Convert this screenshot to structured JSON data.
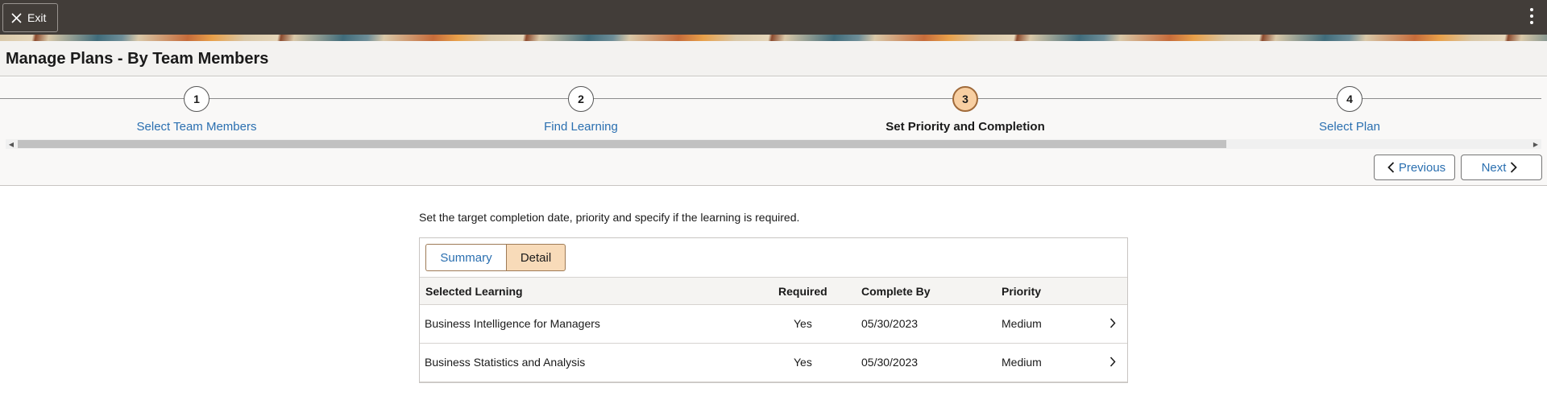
{
  "topbar": {
    "exit_label": "Exit"
  },
  "page": {
    "title": "Manage Plans - By Team Members"
  },
  "train": {
    "steps": [
      {
        "number": "1",
        "label": "Select Team Members"
      },
      {
        "number": "2",
        "label": "Find Learning"
      },
      {
        "number": "3",
        "label": "Set Priority and Completion"
      },
      {
        "number": "4",
        "label": "Select Plan"
      }
    ],
    "current_step": 3
  },
  "nav": {
    "previous_label": "Previous",
    "next_label": "Next"
  },
  "content": {
    "instruction": "Set the target completion date, priority and specify if the learning is required.",
    "segments": {
      "summary": "Summary",
      "detail": "Detail",
      "selected": "Detail"
    },
    "table": {
      "columns": [
        "Selected Learning",
        "Required",
        "Complete By",
        "Priority"
      ],
      "rows": [
        {
          "learning": "Business Intelligence for Managers",
          "required": "Yes",
          "complete_by": "05/30/2023",
          "priority": "Medium"
        },
        {
          "learning": "Business Statistics and Analysis",
          "required": "Yes",
          "complete_by": "05/30/2023",
          "priority": "Medium"
        }
      ]
    }
  },
  "colors": {
    "topbar": "#423d39",
    "link": "#2a6fb0",
    "current_step": "#f8cfa2",
    "selected_segment": "#f8dbb9"
  }
}
